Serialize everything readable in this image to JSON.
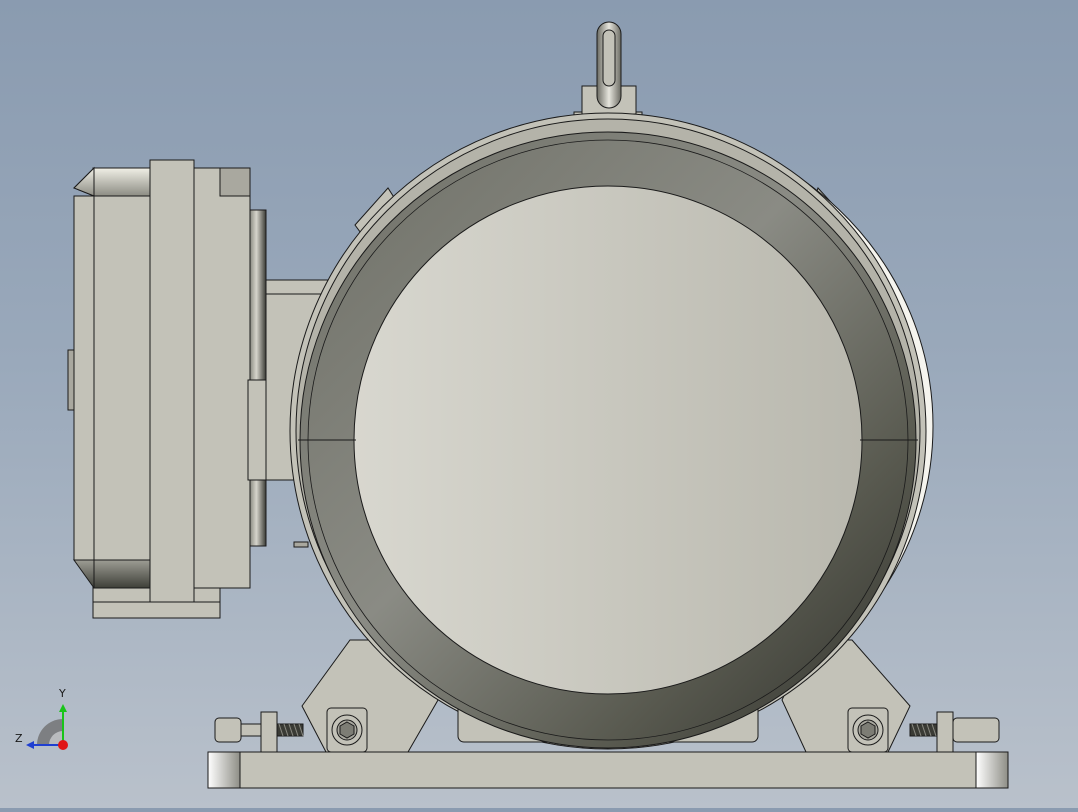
{
  "view": {
    "background_top": "#8a9bb0",
    "background_bottom": "#b9c1cb",
    "part_face_color": "#c3c2b8",
    "edge_color": "#1a1a1a"
  },
  "triad": {
    "y_label": "Y",
    "z_label": "Z",
    "y_color": "#19c419",
    "z_color": "#1f3fd1",
    "x_color": "#e01515"
  }
}
